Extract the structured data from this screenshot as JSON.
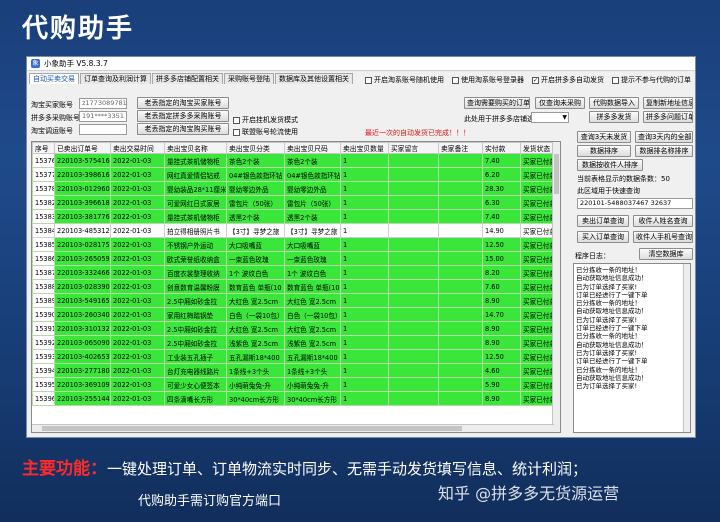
{
  "slide": {
    "title": "代购助手",
    "footer_label": "主要功能：",
    "footer_text": "一键处理订单、订单物流实时同步、无需手动发货填写信息、统计利润；",
    "footer_line2": "代购助手需订购官方端口",
    "watermark": "知乎 @拼多多无货源运营"
  },
  "window": {
    "title": "小象助手 V5.8.3.7",
    "tabs": [
      {
        "label": "自动买卖交易"
      },
      {
        "label": "订单查询及利润计算"
      },
      {
        "label": "拼多多店铺配置相关"
      },
      {
        "label": "采购账号登陆"
      },
      {
        "label": "数据库及其他设置相关"
      }
    ],
    "top_checks": [
      {
        "label": "开启淘系账号随机使用",
        "checked": false
      },
      {
        "label": "使用淘系账号登录器",
        "checked": false
      },
      {
        "label": "开启拼多多自动发货",
        "checked": true
      },
      {
        "label": "提示不参与代购的订单",
        "checked": false
      }
    ]
  },
  "form": {
    "buyer_label": "淘宝买家账号",
    "buyer_value": "z1773089781",
    "pdd_label": "拼多多采购账号",
    "pdd_value": "191****3351",
    "alipay_label": "淘宝调运账号",
    "alipay_value": "",
    "btn_buyer": "老丢指定的淘宝买家账号",
    "btn_pdd": "老丢指定拼多多采购账号",
    "btn_alipay": "老丢指定的淘宝购买账号",
    "chk_multi": "开启挂机发货模式",
    "chk_rotate": "联盟账号轮流使用",
    "red_note": "最近一次的自动发货已完成！！！"
  },
  "center_buttons": {
    "query_order": "查询需要购买的订单",
    "store_select_label": "此处用于拼多多店铺选择",
    "store_select_value": "",
    "only_unsourced": "仅查询未采购",
    "import_pdd": "代购数据导入",
    "copy_addr": "复制新地址信息",
    "pdd_ship": "拼多多发货",
    "pdd_extra": "拼多多问题订单",
    "query_3days": "查询3天未发货",
    "query_3to7": "查询3天内的全部"
  },
  "right_panel": {
    "btn_sort": "数据排序",
    "btn_sort_name": "数据排名称排序",
    "btn_sort_receiver": "数据按收件人排序",
    "stat_text": "当前表格显示的数据条数：50",
    "quick_label": "此区域用于快速查询",
    "quick_value": "220101-5488037467 32637",
    "btn_q_sell": "卖出订单查询",
    "btn_q_receiver": "收件人姓名查询",
    "btn_q_buy": "买入订单查询",
    "btn_q_phone": "收件人手机号查询",
    "log_label": "程序日志：",
    "btn_clear": "清空数据库"
  },
  "grid": {
    "headers": [
      "序号",
      "已卖出订单号",
      "卖出交易时间",
      "卖出宝贝名称",
      "卖出宝贝分类",
      "卖出宝贝尺码",
      "卖出宝贝数量",
      "买家留言",
      "卖家备注",
      "实付款",
      "发货状态"
    ],
    "rows": [
      {
        "idx": "15376",
        "order": "220103-5754164",
        "time": "2022-01-03",
        "name": "量挂式茶机储物柜",
        "cat": "茶色2个装",
        "size": "茶色2个装",
        "qty": "1",
        "msg": "",
        "note": "",
        "pay": "7.40",
        "status": "买家已付款",
        "white": false
      },
      {
        "idx": "15377",
        "order": "220103-3986162",
        "time": "2022-01-03",
        "name": "网红真爱情侣钻戒",
        "cat": "04#银色款指环钻",
        "size": "04#银色款指环钻",
        "qty": "1",
        "msg": "",
        "note": "",
        "pay": "6.20",
        "status": "买家已付款",
        "white": false
      },
      {
        "idx": "15378",
        "order": "220103-0129604",
        "time": "2022-01-03",
        "name": "婴幼装品28*11厘米",
        "cat": "婴幼零边外品",
        "size": "婴幼零边外品",
        "qty": "1",
        "msg": "",
        "note": "",
        "pay": "28.30",
        "status": "买家已付款",
        "white": false
      },
      {
        "idx": "15382",
        "order": "220103-3966187",
        "time": "2022-01-03",
        "name": "可爱网红日式家居",
        "cat": "雷包片（50张）",
        "size": "雷包片（50张）",
        "qty": "1",
        "msg": "",
        "note": "",
        "pay": "6.30",
        "status": "买家已付款",
        "white": false
      },
      {
        "idx": "15383",
        "order": "220103-3817766",
        "time": "2022-01-03",
        "name": "量挂式茶机储物柜",
        "cat": "透黑2个装",
        "size": "透黑2个装",
        "qty": "1",
        "msg": "",
        "note": "",
        "pay": "7.40",
        "status": "买家已付款",
        "white": false
      },
      {
        "idx": "15384",
        "order": "220103-4853124",
        "time": "2022-01-03",
        "name": "拍立得相册照片书",
        "cat": "【3寸】寻梦之旅",
        "size": "【3寸】寻梦之旅",
        "qty": "1",
        "msg": "",
        "note": "",
        "pay": "14.90",
        "status": "买家已付款",
        "white": true
      },
      {
        "idx": "15385",
        "order": "220103-0281752",
        "time": "2022-01-03",
        "name": "不锈钢户外运动",
        "cat": "大口吸嘴蓝",
        "size": "大口吸嘴蓝",
        "qty": "1",
        "msg": "",
        "note": "",
        "pay": "12.50",
        "status": "买家已付款",
        "white": false
      },
      {
        "idx": "15386",
        "order": "220103-2650598",
        "time": "2022-01-03",
        "name": "欧式荣誉纸收纳盒",
        "cat": "一束蓝色玫瑰",
        "size": "一束蓝色玫瑰",
        "qty": "1",
        "msg": "",
        "note": "",
        "pay": "15.00",
        "status": "买家已付款",
        "white": false
      },
      {
        "idx": "15387",
        "order": "220103-3324662",
        "time": "2022-01-03",
        "name": "百度衣裳整理收纳",
        "cat": "1个 波纹白色",
        "size": "1个 波纹白色",
        "qty": "1",
        "msg": "",
        "note": "",
        "pay": "8.20",
        "status": "买家已付款",
        "white": false
      },
      {
        "idx": "15388",
        "order": "220103-0283902",
        "time": "2022-01-03",
        "name": "创意数育温馨粉膜",
        "cat": "数育蓝色 单瓶(10",
        "size": "数育蓝色 单瓶(10",
        "qty": "1",
        "msg": "",
        "note": "",
        "pay": "7.60",
        "status": "买家已付款",
        "white": false
      },
      {
        "idx": "15389",
        "order": "220103-5491656",
        "time": "2022-01-03",
        "name": "2.5中厢如砂金拉",
        "cat": "大红色 宽2.5cm",
        "size": "大红色 宽2.5cm",
        "qty": "1",
        "msg": "",
        "note": "",
        "pay": "8.90",
        "status": "买家已付款",
        "white": false
      },
      {
        "idx": "15390",
        "order": "220103-2603405",
        "time": "2022-01-03",
        "name": "家用红梅踏锅垫",
        "cat": "白色（一袋10包）",
        "size": "白色（一袋10包）",
        "qty": "1",
        "msg": "",
        "note": "",
        "pay": "14.70",
        "status": "买家已付款",
        "white": false
      },
      {
        "idx": "15391",
        "order": "220103-3101321",
        "time": "2022-01-03",
        "name": "2.5中厢如砂金拉",
        "cat": "大红色 宽2.5cm",
        "size": "大红色 宽2.5cm",
        "qty": "1",
        "msg": "",
        "note": "",
        "pay": "8.90",
        "status": "买家已付款",
        "white": false
      },
      {
        "idx": "15392",
        "order": "220103-0650906",
        "time": "2022-01-03",
        "name": "2.5中厢如砂金拉",
        "cat": "浅紫色 宽2.5cm",
        "size": "浅紫色 宽2.5cm",
        "qty": "1",
        "msg": "",
        "note": "",
        "pay": "8.90",
        "status": "买家已付款",
        "white": false
      },
      {
        "idx": "15393",
        "order": "220103-4026531",
        "time": "2022-01-03",
        "name": "工业装五孔插子",
        "cat": "五孔漏斯18*400",
        "size": "五孔漏斯18*400",
        "qty": "1",
        "msg": "",
        "note": "",
        "pay": "12.50",
        "status": "买家已付款",
        "white": false
      },
      {
        "idx": "15394",
        "order": "220103-2771806",
        "time": "2022-01-03",
        "name": "台灯充电器线路片",
        "cat": "1条线+3个头",
        "size": "1条线+3个头",
        "qty": "1",
        "msg": "",
        "note": "",
        "pay": "4.60",
        "status": "买家已付款",
        "white": false
      },
      {
        "idx": "15395",
        "order": "220103-3691095",
        "time": "2022-01-03",
        "name": "可爱少女心便签本",
        "cat": "小纯萌兔兔-升",
        "size": "小纯萌兔兔-升",
        "qty": "1",
        "msg": "",
        "note": "",
        "pay": "5.90",
        "status": "买家已付款",
        "white": false
      },
      {
        "idx": "15396",
        "order": "220103-2551441",
        "time": "2022-01-03",
        "name": "四条滴嘴长方形",
        "cat": "30*40cm长方形",
        "size": "30*40cm长方形",
        "qty": "1",
        "msg": "",
        "note": "",
        "pay": "8.90",
        "status": "买家已付款",
        "white": false
      }
    ]
  },
  "log_lines": [
    "已分拣收一条的地址！",
    "自动获取地址信息成功！",
    "已为订单选择了买家!",
    "订单已经进行了一键下单",
    "已分拣收一条的地址！",
    "自动获取地址信息成功！",
    "已为订单选择了买家!",
    "订单已经进行了一键下单",
    "已分拣收一条的地址！",
    "自动获取地址信息成功！",
    "已为订单选择了买家!",
    "订单已经进行了一键下单",
    "已分拣收一条的地址！",
    "自动获取地址信息成功！",
    "已为订单选择了买家!"
  ],
  "colors": {
    "row_green": "#39e639",
    "slide_bg": "#1f4a8a",
    "accent_red": "#ff2a2a"
  }
}
